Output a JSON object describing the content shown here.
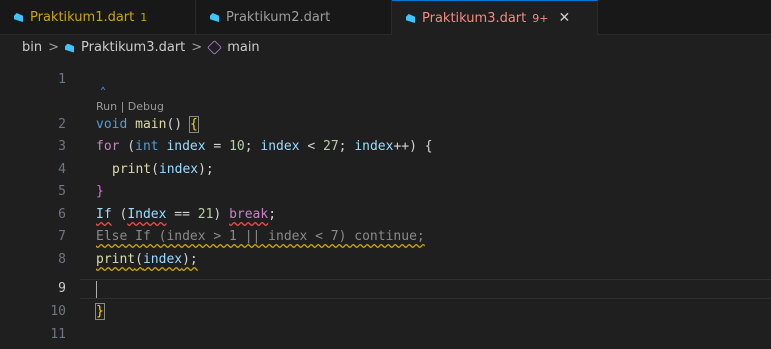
{
  "tabs": [
    {
      "name": "Praktikum1.dart",
      "badge": "1"
    },
    {
      "name": "Praktikum2.dart",
      "badge": ""
    },
    {
      "name": "Praktikum3.dart",
      "badge": "9+",
      "close": "✕"
    }
  ],
  "breadcrumb": {
    "folder": "bin",
    "file": "Praktikum3.dart",
    "symbol": "main",
    "sep": ">"
  },
  "codelens": "Run | Debug",
  "fold_glyph": "⌃",
  "lines": [
    {
      "num": "1"
    },
    {
      "num": "2"
    },
    {
      "num": "3"
    },
    {
      "num": "4"
    },
    {
      "num": "5"
    },
    {
      "num": "6"
    },
    {
      "num": "7"
    },
    {
      "num": "8"
    },
    {
      "num": "9"
    },
    {
      "num": "10"
    },
    {
      "num": "11"
    }
  ],
  "code": {
    "l2": [
      "void",
      " ",
      "main",
      "() ",
      "{"
    ],
    "l3": [
      "for",
      " (",
      "int",
      " ",
      "index",
      " = ",
      "10",
      "; ",
      "index",
      " < ",
      "27",
      "; ",
      "index",
      "++) {"
    ],
    "l4": [
      "print",
      "(",
      "index",
      ");"
    ],
    "l5": [
      "}"
    ],
    "l6": [
      "If",
      " (",
      "Index",
      " == ",
      "21",
      ") ",
      "break",
      ";"
    ],
    "l7": [
      "Else If (index > 1 || index < 7) continue;"
    ],
    "l8": [
      "print",
      "(",
      "index",
      ");"
    ],
    "l10": [
      "}"
    ]
  }
}
